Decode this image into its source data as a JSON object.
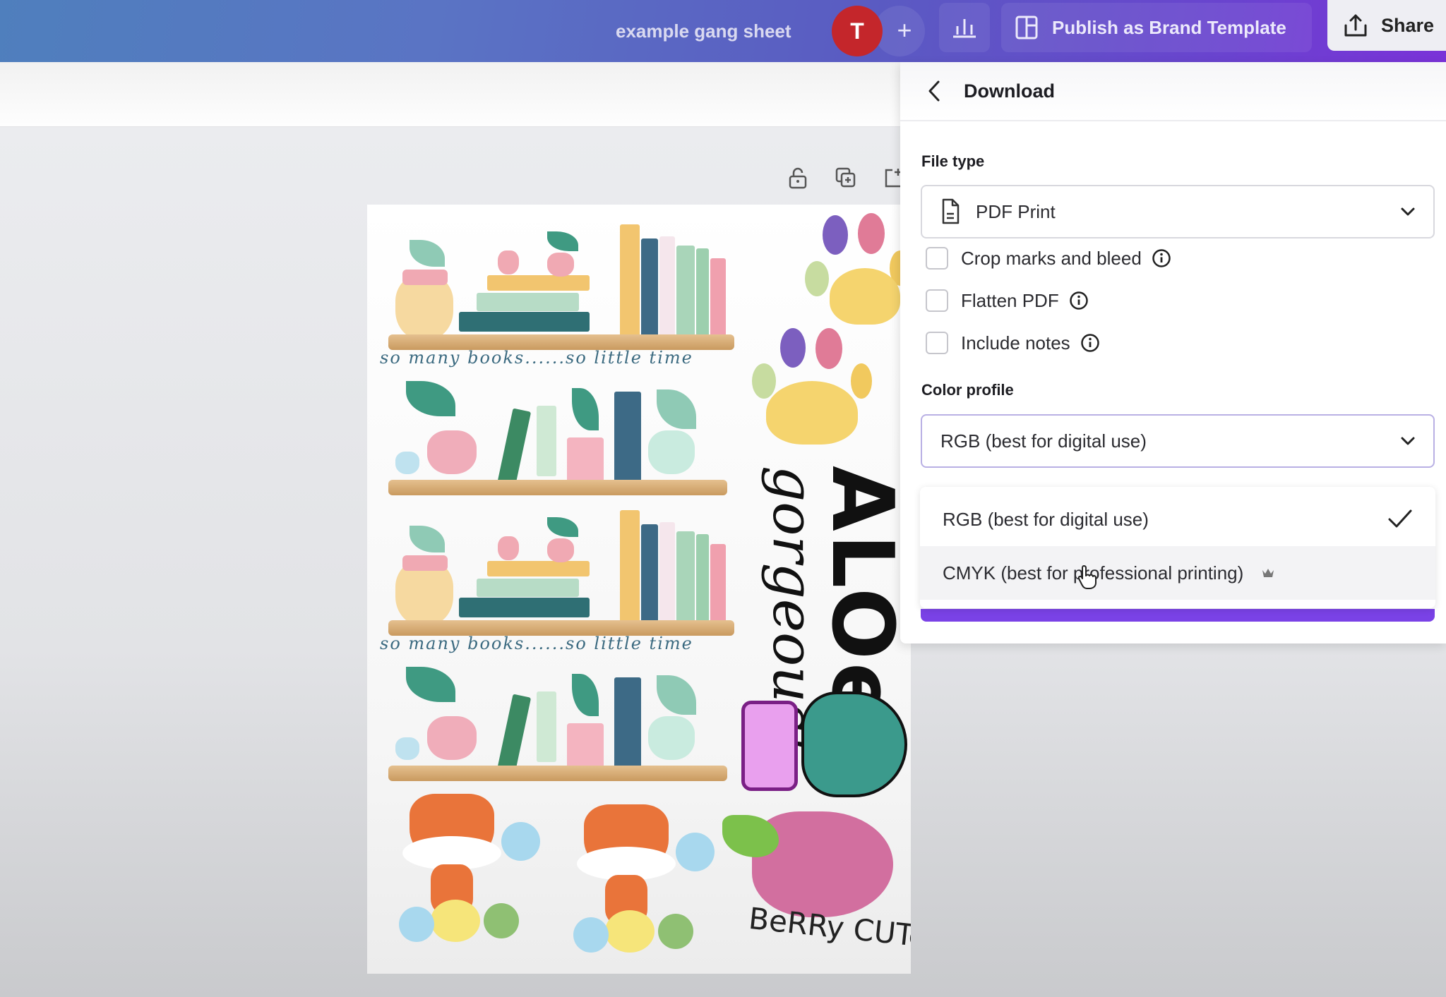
{
  "header": {
    "document_title": "example gang sheet",
    "avatar_initial": "T",
    "add_collaborator_label": "+",
    "publish_label": "Publish as Brand Template",
    "share_label": "Share",
    "colors": {
      "avatar": "#c4262b",
      "accent": "#7a42e6"
    }
  },
  "page_tools": {
    "icons": [
      "lock-open-icon",
      "duplicate-page-icon",
      "add-page-icon"
    ]
  },
  "design": {
    "shelf_caption_1": "so many books......so little time",
    "shelf_caption_2": "so many books......so little time",
    "aloe_title": "ALOe",
    "aloe_subtitle": "gorgeous!",
    "berry_text": "BeRRy CUTe"
  },
  "download_panel": {
    "title": "Download",
    "file_type": {
      "label": "File type",
      "value": "PDF Print"
    },
    "options": [
      {
        "label": "Crop marks and bleed",
        "checked": false
      },
      {
        "label": "Flatten PDF",
        "checked": false
      },
      {
        "label": "Include notes",
        "checked": false
      }
    ],
    "color_profile": {
      "label": "Color profile",
      "value": "RGB (best for digital use)",
      "menu": [
        {
          "label": "RGB (best for digital use)",
          "selected": true,
          "premium": false
        },
        {
          "label": "CMYK (best for professional printing)",
          "selected": false,
          "premium": true
        }
      ]
    }
  }
}
